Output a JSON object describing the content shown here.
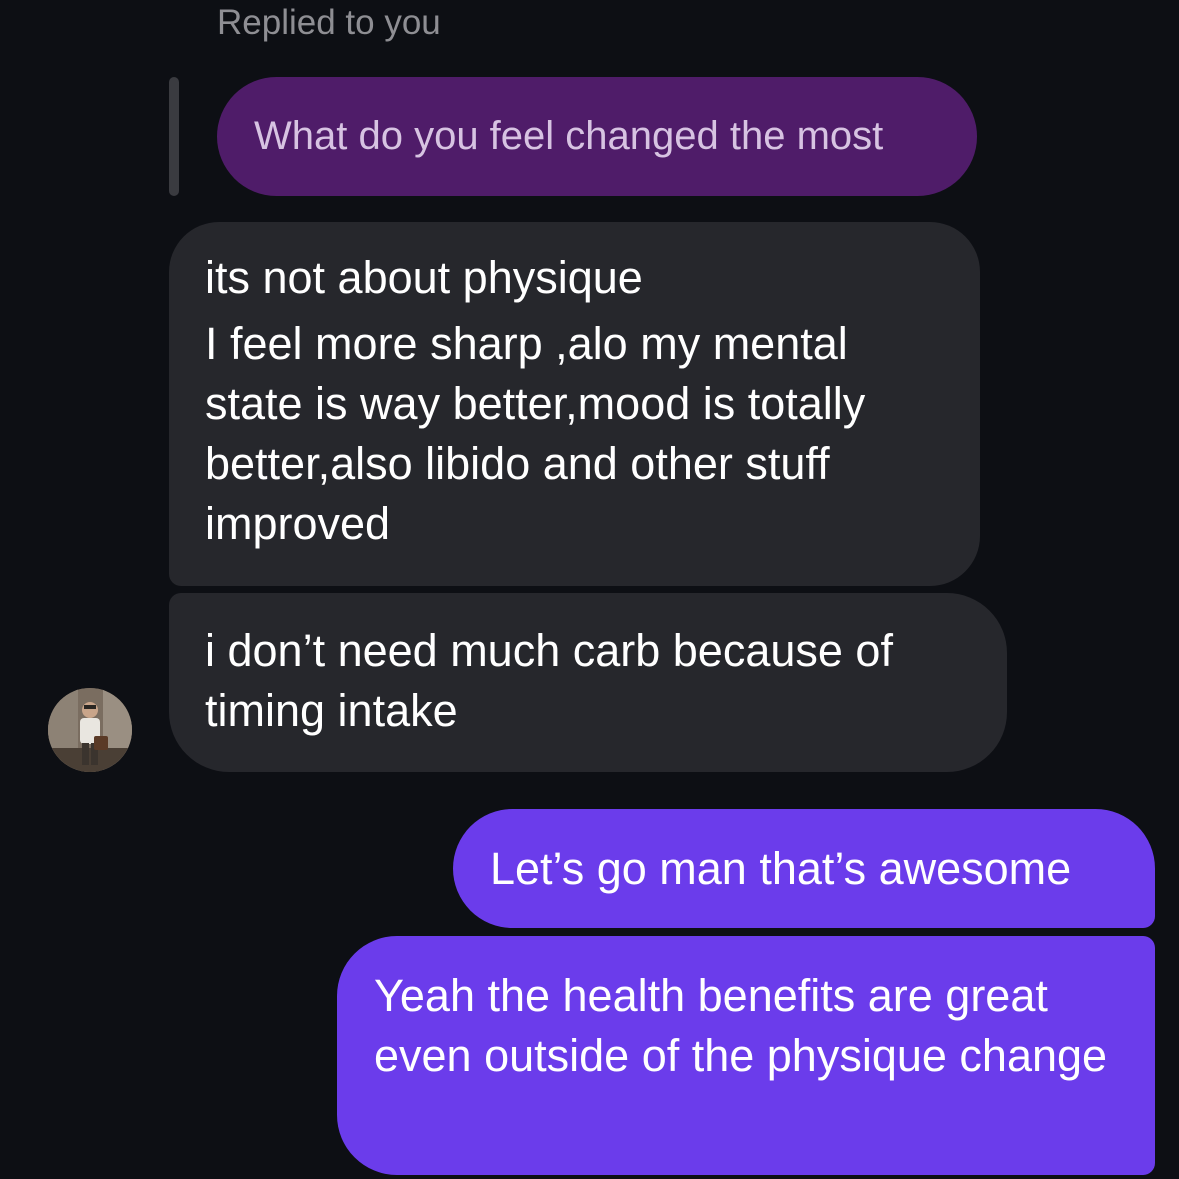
{
  "reply_header": {
    "label": "Replied to you"
  },
  "quoted_message": {
    "text": "What do you feel changed the most"
  },
  "incoming_messages": [
    {
      "lines": [
        "its not about physique",
        "I feel more sharp ,alo my mental state is way better,mood is totally better,also libido and other stuff improved"
      ]
    },
    {
      "text": "i don’t need much carb because of timing intake"
    }
  ],
  "outgoing_messages": [
    {
      "text": "Let’s go man that’s awesome"
    },
    {
      "text": "Yeah the health benefits are great even outside of the physique change"
    }
  ],
  "contact": {
    "avatar_icon": "profile-photo-icon"
  },
  "colors": {
    "background": "#0d0f14",
    "incoming_bubble": "#26272c",
    "outgoing_bubble": "#6b3ceb",
    "quoted_bubble": "#4f1c69"
  }
}
